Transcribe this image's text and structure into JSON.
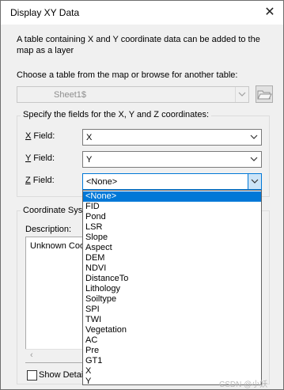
{
  "dialog": {
    "title": "Display XY Data",
    "description": "A table containing X and Y coordinate data can be added to the map as a layer",
    "choose_label": "Choose a table from the map or browse for another table:",
    "table_value": "Sheet1$",
    "fields_group_label": "Specify the fields for the X, Y and Z coordinates:",
    "x_field": {
      "label_key": "X",
      "label_rest": " Field:",
      "value": "X"
    },
    "y_field": {
      "label_key": "Y",
      "label_rest": " Field:",
      "value": "Y"
    },
    "z_field": {
      "label_key": "Z",
      "label_rest": " Field:",
      "value": "<None>"
    },
    "coord_group_label": "Coordinate Sys",
    "description_label": "Description:",
    "description_value": "Unknown Coo",
    "show_details_label": "Show Detail"
  },
  "dropdown": {
    "options": [
      "<None>",
      "FID",
      "Pond",
      "LSR",
      "Slope",
      "Aspect",
      "DEM",
      "NDVI",
      "DistanceTo",
      "Lithology",
      "Soiltype",
      "SPI",
      "TWI",
      "Vegetation",
      "AC",
      "Pre",
      "GT1",
      "X",
      "Y"
    ],
    "selected": "<None>"
  },
  "watermark": "CSDN @小妖T800",
  "colors": {
    "selection": "#0078d7",
    "focus_border": "#0078d7"
  }
}
